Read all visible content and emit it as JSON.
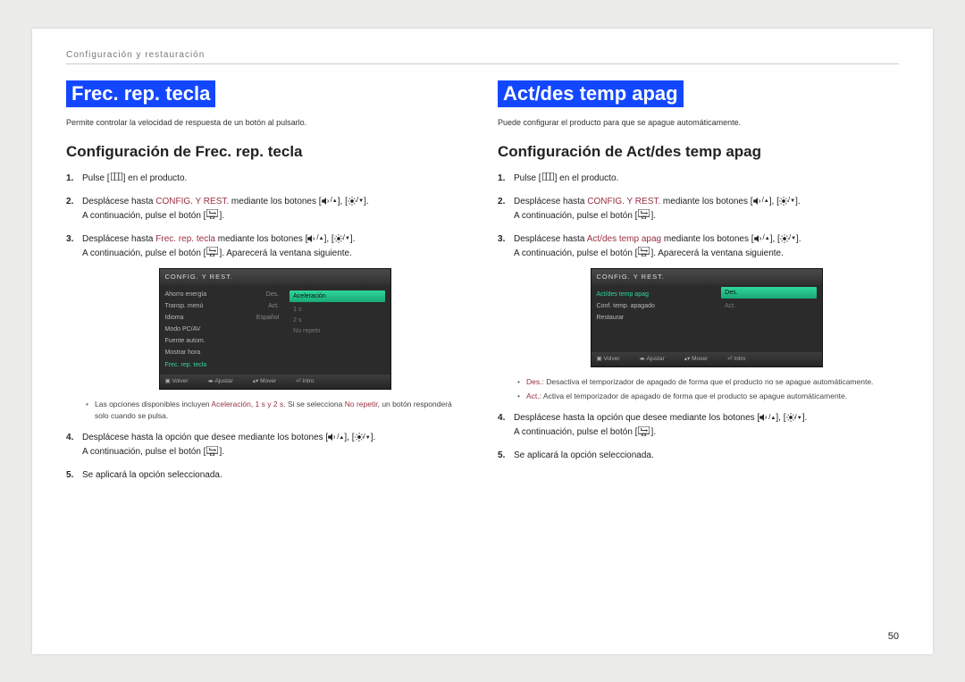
{
  "header": {
    "section": "Configuración y restauración"
  },
  "page_number": "50",
  "left": {
    "title": "Frec. rep. tecla",
    "lead": "Permite controlar la velocidad de respuesta de un botón al pulsarlo.",
    "subhead": "Configuración de Frec. rep. tecla",
    "step1_a": "Pulse [",
    "step1_b": "] en el producto.",
    "step2_a": "Desplácese hasta ",
    "step2_menu": "CONFIG. Y REST.",
    "step2_b": " mediante los botones [",
    "step2_c": "], [",
    "step2_d": "].",
    "step2_e": "A continuación, pulse el botón [",
    "step2_f": "].",
    "step3_a": "Desplácese hasta ",
    "step3_item": "Frec. rep. tecla",
    "step3_b": " mediante los botones [",
    "step3_c": "], [",
    "step3_d": "].",
    "step3_e": "A continuación, pulse el botón [",
    "step3_f": "]. Aparecerá la ventana siguiente.",
    "osd": {
      "title": "CONFIG. Y REST.",
      "rows": [
        {
          "lbl": "Ahorro energía",
          "val": "Des."
        },
        {
          "lbl": "Transp. menú",
          "val": "Act."
        },
        {
          "lbl": "Idioma",
          "val": "Español"
        },
        {
          "lbl": "Modo PC/AV",
          "val": ""
        },
        {
          "lbl": "Fuente autom.",
          "val": ""
        },
        {
          "lbl": "Mostrar hora",
          "val": ""
        }
      ],
      "active_row": "Frec. rep. tecla",
      "options_highlight": "Aceleración",
      "options": [
        "1 s",
        "2 s",
        "No repetir"
      ],
      "foot": [
        "Volver",
        "Ajustar",
        "Mover",
        "Intro"
      ]
    },
    "note_a": "Las opciones disponibles incluyen ",
    "note_opts": "Aceleración, 1 s y 2 s",
    "note_b": ". Si se selecciona ",
    "note_norep": "No repetir",
    "note_c": ", un botón responderá solo cuando se pulsa.",
    "step4_a": "Desplácese hasta la opción que desee mediante los botones [",
    "step4_b": "], [",
    "step4_c": "].",
    "step4_d": "A continuación, pulse el botón [",
    "step4_e": "].",
    "step5": "Se aplicará la opción seleccionada."
  },
  "right": {
    "title": "Act/des temp apag",
    "lead": "Puede configurar el producto para que se apague automáticamente.",
    "subhead": "Configuración de Act/des temp apag",
    "step1_a": "Pulse [",
    "step1_b": "] en el producto.",
    "step2_a": "Desplácese hasta ",
    "step2_menu": "CONFIG. Y REST.",
    "step2_b": " mediante los botones [",
    "step2_c": "], [",
    "step2_d": "].",
    "step2_e": "A continuación, pulse el botón [",
    "step2_f": "].",
    "step3_a": "Desplácese hasta ",
    "step3_item": "Act/des temp apag",
    "step3_b": " mediante los botones [",
    "step3_c": "], [",
    "step3_d": "].",
    "step3_e": "A continuación, pulse el botón [",
    "step3_f": "]. Aparecerá la ventana siguiente.",
    "osd": {
      "title": "CONFIG. Y REST.",
      "active_row": "Act/des temp apag",
      "rows": [
        {
          "lbl": "Conf. temp. apagado",
          "val": ""
        },
        {
          "lbl": "Restaurar",
          "val": ""
        }
      ],
      "options_highlight": "Des.",
      "options": [
        "Act."
      ],
      "foot": [
        "Volver",
        "Ajustar",
        "Mover",
        "Intro"
      ]
    },
    "note1_a": "Des.: ",
    "note1_b": "Desactiva el temporizador de apagado de forma que el producto no se apague automáticamente.",
    "note2_a": "Act.: ",
    "note2_b": "Activa el temporizador de apagado de forma que el producto se apague automáticamente.",
    "step4_a": "Desplácese hasta la opción que desee mediante los botones [",
    "step4_b": "], [",
    "step4_c": "].",
    "step4_d": "A continuación, pulse el botón [",
    "step4_e": "].",
    "step5": "Se aplicará la opción seleccionada."
  }
}
